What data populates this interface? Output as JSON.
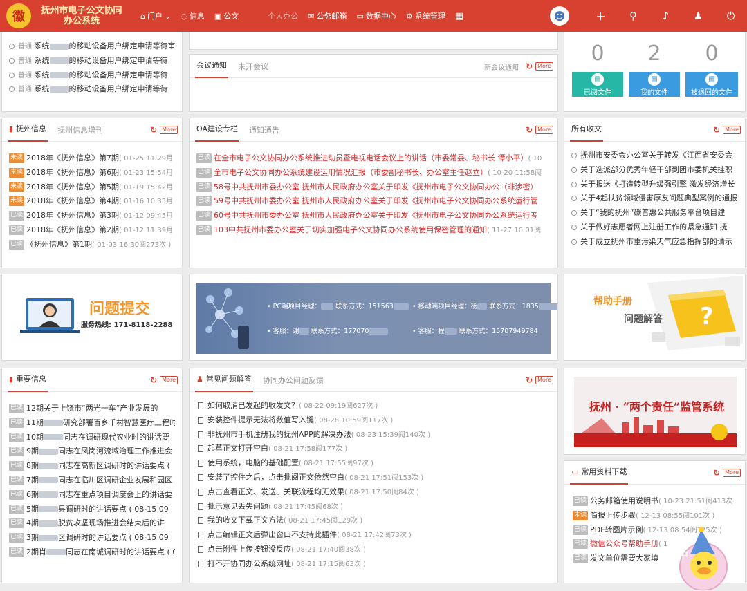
{
  "header": {
    "logo_glyph": "徽",
    "title_line1": "抚州市电子公文协同",
    "title_line2": "办公系统",
    "nav": [
      {
        "label": "门户",
        "icon": "home-icon",
        "has_dropdown": true
      },
      {
        "label": "信息",
        "icon": "chat-icon"
      },
      {
        "label": "公文",
        "icon": "briefcase-icon"
      },
      {
        "label": "个人办公",
        "icon": "user-icon",
        "dim": true
      },
      {
        "label": "公务邮箱",
        "icon": "mail-icon"
      },
      {
        "label": "数据中心",
        "icon": "monitor-icon"
      },
      {
        "label": "系统管理",
        "icon": "settings-icon"
      }
    ]
  },
  "top_notices": [
    {
      "level": "普通",
      "text": "系统",
      "suffix": "的移动设备用户绑定申请等待审"
    },
    {
      "level": "普通",
      "text": "系统",
      "suffix": "的移动设备用户绑定申请等待"
    },
    {
      "level": "普通",
      "text": "系统",
      "suffix": "的移动设备用户绑定申请等待"
    },
    {
      "level": "普通",
      "text": "系统",
      "suffix": "的移动设备用户绑定申请等待"
    }
  ],
  "meeting": {
    "tab_active": "会议通知",
    "tab_other": "未开会议",
    "extra": "新会议通知",
    "more": "More"
  },
  "stats": [
    {
      "value": "0",
      "label": "已阅文件",
      "color": "#27b7a7"
    },
    {
      "value": "2",
      "label": "我的文件",
      "color": "#3a9be0"
    },
    {
      "value": "0",
      "label": "被退回的文件",
      "color": "#3a9be0"
    }
  ],
  "fuzhou_info": {
    "tab_active": "抚州信息",
    "tab_other": "抚州信息增刊",
    "more": "More",
    "items": [
      {
        "tag": "未读",
        "unread": true,
        "title": "2018年《抚州信息》第7期",
        "meta": "( 01-25 11:29月"
      },
      {
        "tag": "未读",
        "unread": true,
        "title": "2018年《抚州信息》第6期",
        "meta": "( 01-23 15:54月"
      },
      {
        "tag": "未读",
        "unread": true,
        "title": "2018年《抚州信息》第5期",
        "meta": "( 01-19 15:42月"
      },
      {
        "tag": "未读",
        "unread": true,
        "title": "2018年《抚州信息》第4期",
        "meta": "( 01-16 10:35月"
      },
      {
        "tag": "已读",
        "unread": false,
        "title": "2018年《抚州信息》第3期",
        "meta": "( 01-12 09:45月"
      },
      {
        "tag": "已读",
        "unread": false,
        "title": "2018年《抚州信息》第2期",
        "meta": "( 01-12 11:39月"
      },
      {
        "tag": "已读",
        "unread": false,
        "title": "《抚州信息》第1期",
        "meta": "( 01-03 16:30阅273次 )"
      }
    ]
  },
  "oa_column": {
    "tab_active": "OA建设专栏",
    "tab_other": "通知通告",
    "more": "More",
    "items": [
      {
        "tag": "已读",
        "title": "在全市电子公文协同办公系统推进动员暨电视电话会议上的讲话（市委常委、秘书长 谭小平）",
        "meta": "( 10"
      },
      {
        "tag": "已读",
        "title": "全市电子公文协同办公系统建设运用情况汇报（市委副秘书长、办公室主任赵立）",
        "meta": "( 10-20 11:58阅"
      },
      {
        "tag": "已读",
        "title": "58号中共抚州市委办公室 抚州市人民政府办公室关于印发《抚州市电子公文协同办公（非涉密）",
        "meta": ""
      },
      {
        "tag": "已读",
        "title": "59号中共抚州市委办公室 抚州市人民政府办公室关于印发《抚州市电子公文协同办公系统运行管",
        "meta": ""
      },
      {
        "tag": "已读",
        "title": "60号中共抚州市委办公室 抚州市人民政府办公室关于印发《抚州市电子公文协同办公系统运行考",
        "meta": ""
      },
      {
        "tag": "已读",
        "title": "103中共抚州市委办公室关于切实加强电子公文协同办公系统使用保密管理的通知",
        "meta": "( 11-27 10:01阅"
      }
    ]
  },
  "received_docs": {
    "tab_active": "所有收文",
    "more": "More",
    "items": [
      "抚州市安委会办公室关于转发《江西省安委会",
      "关于选派部分优秀年轻干部到团市委机关挂职",
      "关于报送《打造转型升级强引擎 激发经济增长",
      "关于4起扶贫领域侵害厚友问题典型案例的通报",
      "关于“我的抚州”碳普惠公共服务平台项目建",
      "关于做好志愿者网上注册工作的紧急通知  抚",
      "关于成立抚州市重污染天气应急指挥部的请示"
    ]
  },
  "banner_issue": {
    "title": "问题提交",
    "hotline": "服务热线: 171-8118-2288"
  },
  "banner_contacts": {
    "line1a": "• PC端项目经理：",
    "line1b": "联系方式：151563",
    "line1c": "• 移动端项目经理：杨",
    "line1d": "联系方式：1835",
    "line2a": "• 客服：谢",
    "line2b": "联系方式：177070",
    "line2c": "• 客服：程",
    "line2d": "联系方式：15707949784"
  },
  "banner_help": {
    "title": "帮助手册",
    "sub": "问题解答"
  },
  "important_info": {
    "tab_active": "重要信息",
    "more": "More",
    "items": [
      {
        "tag": "已读",
        "title": "12期关于上饶市“两光一车”产业发展的"
      },
      {
        "tag": "已读",
        "title": "11期",
        "suffix": "研究部署百乡千村智慧医疗工程时的讲"
      },
      {
        "tag": "已读",
        "title": "10期",
        "suffix": "同志在调研现代农业时的讲话要"
      },
      {
        "tag": "已读",
        "title": "9期",
        "suffix": "同志在凤岗河流域治理工作推进会"
      },
      {
        "tag": "已读",
        "title": "8期",
        "suffix": "同志在高新区调研时的讲话要点 ("
      },
      {
        "tag": "已读",
        "title": "7期",
        "suffix": "同志在临川区调研企业发展和园区"
      },
      {
        "tag": "已读",
        "title": "6期",
        "suffix": "同志在重点项目调度会上的讲话要"
      },
      {
        "tag": "已读",
        "title": "5期",
        "suffix": "县调研时的讲话要点 ( 08-15 09"
      },
      {
        "tag": "已读",
        "title": "4期",
        "suffix": "脱贫攻坚现场推进会结束后的讲"
      },
      {
        "tag": "已读",
        "title": "3期",
        "suffix": "区调研时的讲话要点 ( 08-15 09"
      },
      {
        "tag": "已读",
        "title": "2期肖",
        "suffix": "同志在南城调研时的讲话要点 ( 08"
      }
    ]
  },
  "faq": {
    "tab_active": "常见问题解答",
    "tab_other": "协同办公问题反馈",
    "more": "More",
    "items": [
      {
        "title": "如何取消已发起的收发文？",
        "meta": "( 08-22 09:19阅627次 )"
      },
      {
        "title": "安装控件提示无法将数值写入键",
        "meta": "( 08-28 10:59阅117次 )"
      },
      {
        "title": "非抚州市手机注册我的抚州APP的解决办法",
        "meta": "( 08-23 15:39阅140次 )"
      },
      {
        "title": "起草正文打开空白",
        "meta": "( 08-21 17:58阅177次 )"
      },
      {
        "title": "使用系统，电脑的基础配置",
        "meta": "( 08-21 17:55阅97次 )"
      },
      {
        "title": "安装了控件之后，点击批阅正文依然空白",
        "meta": "( 08-21 17:51阅153次 )"
      },
      {
        "title": "点击查看正文、发送、关联流程均无效果",
        "meta": "( 08-21 17:50阅84次 )"
      },
      {
        "title": "批示意见丢失问题",
        "meta": "( 08-21 17:45阅68次 )"
      },
      {
        "title": "我的收文下载正文方法",
        "meta": "( 08-21 17:45阅129次 )"
      },
      {
        "title": "点击编辑正文后弹出窗口不支持此插件",
        "meta": "( 08-21 17:42阅73次 )"
      },
      {
        "title": "点击附件上传按钮没反应",
        "meta": "( 08-21 17:40阅38次 )"
      },
      {
        "title": "打不开协同办公系统网址",
        "meta": "( 08-21 17:15阅63次 )"
      }
    ]
  },
  "supervision_banner": {
    "title": "抚州 · “两个责任”监管系统"
  },
  "downloads": {
    "tab_active": "常用资料下载",
    "more": "More",
    "items": [
      {
        "tag": "已读",
        "unread": false,
        "title": "公务邮箱使用说明书",
        "meta": "( 10-23 21:51阅413次",
        "red": false
      },
      {
        "tag": "未读",
        "unread": true,
        "title": "简报上传步骤",
        "meta": "( 12-13 08:55阅101次 )",
        "red": false
      },
      {
        "tag": "已读",
        "unread": false,
        "title": "PDF转图片示例",
        "meta": "( 12-13 08:54阅125次 )",
        "red": false
      },
      {
        "tag": "已读",
        "unread": false,
        "title": "微信公众号帮助手册",
        "meta": "( 1",
        "red": true
      },
      {
        "tag": "已读",
        "unread": false,
        "title": "发文单位需要大家填",
        "meta": "",
        "red": false
      }
    ]
  },
  "mascot_char": "中"
}
